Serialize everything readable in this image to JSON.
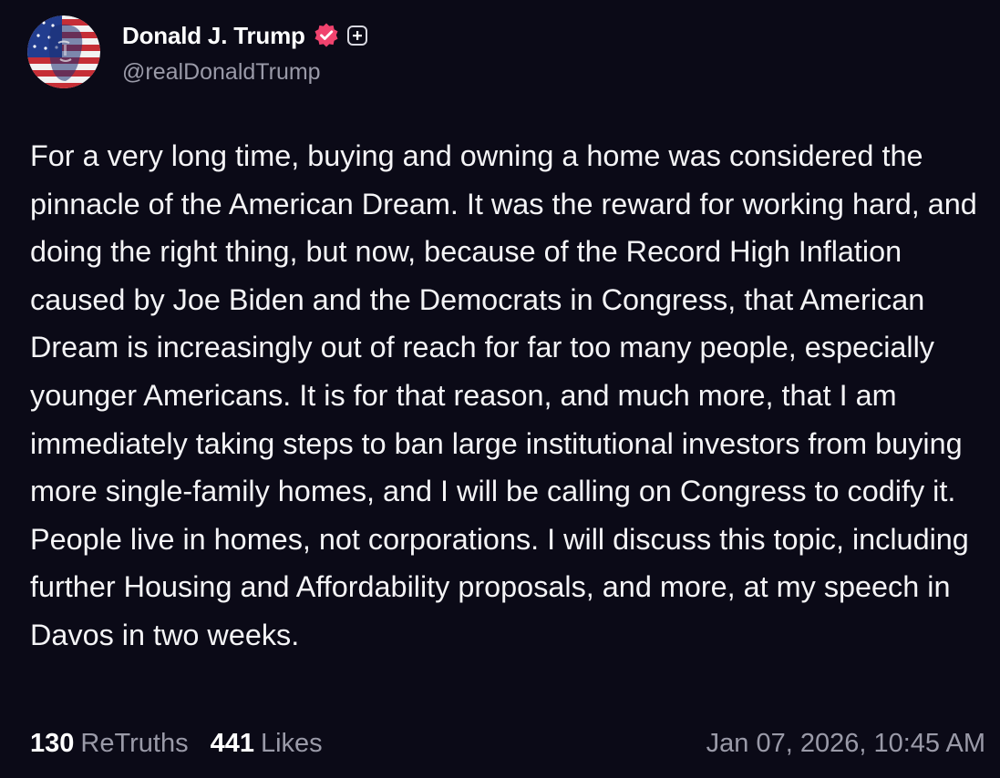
{
  "post": {
    "author": {
      "display_name": "Donald J. Trump",
      "handle": "@realDonaldTrump",
      "avatar_icon": "avatar-flag-portrait",
      "verified_icon": "verified-badge-icon",
      "verified_color": "#f0436e",
      "plus_icon": "plus-icon"
    },
    "text": "For a very long time, buying and owning a home was considered the pinnacle of the American Dream. It was the reward for working hard, and doing the right thing, but now, because of the Record High Inflation caused by Joe Biden and the Democrats in Congress, that American Dream is increasingly out of reach for far too many people, especially younger Americans. It is for that reason, and much more, that I am immediately taking steps to ban large institutional investors from buying more single-family homes, and I will be calling on Congress to codify it. People live in homes, not corporations. I will discuss this topic, including further Housing and Affordability proposals, and more, at my speech in Davos in two weeks.",
    "stats": {
      "retruths_count": "130",
      "retruths_label": "ReTruths",
      "likes_count": "441",
      "likes_label": "Likes"
    },
    "timestamp": "Jan 07, 2026, 10:45 AM"
  },
  "colors": {
    "background": "#0b0a17",
    "text": "#f4f4f6",
    "muted": "#9a9aa8"
  }
}
